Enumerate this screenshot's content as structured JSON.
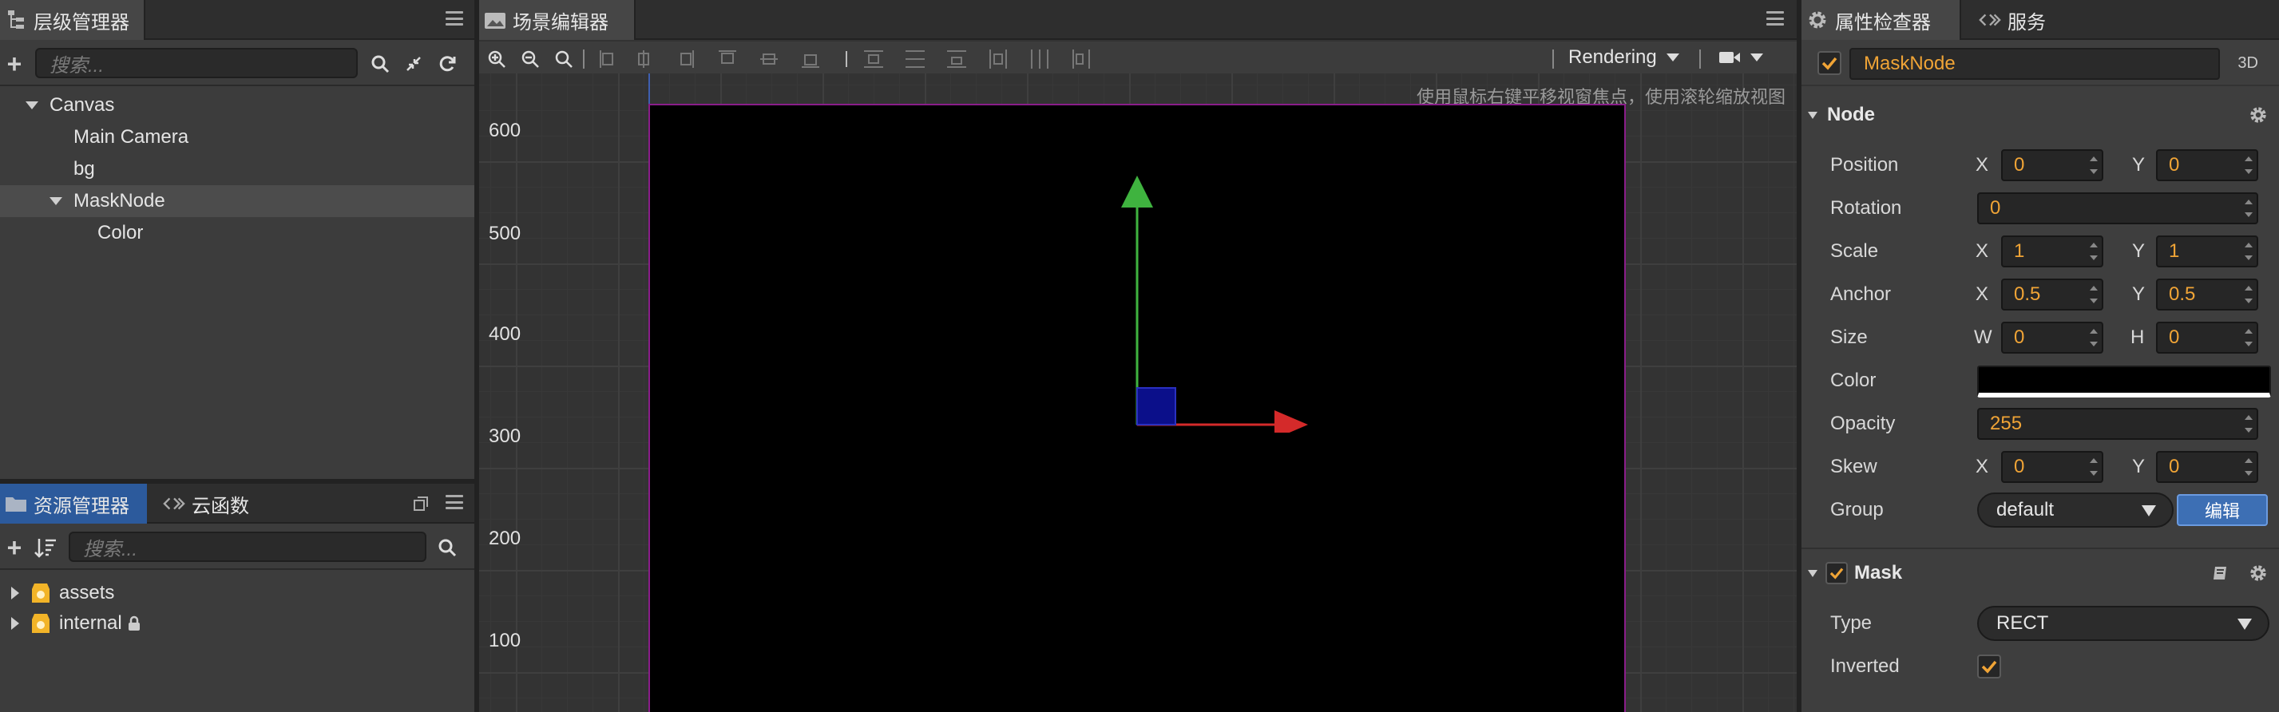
{
  "hierarchy": {
    "tab_label": "层级管理器",
    "search_placeholder": "搜索...",
    "nodes": [
      {
        "label": "Canvas",
        "expanded": true
      },
      {
        "label": "Main Camera"
      },
      {
        "label": "bg"
      },
      {
        "label": "MaskNode",
        "expanded": true,
        "selected": true
      },
      {
        "label": "Color"
      }
    ]
  },
  "assets": {
    "tab_label": "资源管理器",
    "tab2_label": "云函数",
    "search_placeholder": "搜索...",
    "items": [
      {
        "label": "assets"
      },
      {
        "label": "internal",
        "locked": true
      }
    ]
  },
  "scene": {
    "tab_label": "场景编辑器",
    "rendering_label": "Rendering",
    "hint": "使用鼠标右键平移视窗焦点，使用滚轮缩放视图",
    "y_ticks": [
      "600",
      "500",
      "400",
      "300",
      "200",
      "100"
    ]
  },
  "inspector": {
    "tab_label": "属性检查器",
    "tab2_label": "服务",
    "node_name": "MaskNode",
    "mode_label": "3D",
    "node_section": "Node",
    "position": {
      "label": "Position",
      "x_label": "X",
      "x": "0",
      "y_label": "Y",
      "y": "0"
    },
    "rotation": {
      "label": "Rotation",
      "value": "0"
    },
    "scale": {
      "label": "Scale",
      "x_label": "X",
      "x": "1",
      "y_label": "Y",
      "y": "1"
    },
    "anchor": {
      "label": "Anchor",
      "x_label": "X",
      "x": "0.5",
      "y_label": "Y",
      "y": "0.5"
    },
    "size": {
      "label": "Size",
      "w_label": "W",
      "w": "0",
      "h_label": "H",
      "h": "0"
    },
    "color": {
      "label": "Color",
      "value": "#000000"
    },
    "opacity": {
      "label": "Opacity",
      "value": "255"
    },
    "skew": {
      "label": "Skew",
      "x_label": "X",
      "x": "0",
      "y_label": "Y",
      "y": "0"
    },
    "group": {
      "label": "Group",
      "value": "default",
      "edit_label": "编辑"
    },
    "mask_section": "Mask",
    "type": {
      "label": "Type",
      "value": "RECT"
    },
    "inverted": {
      "label": "Inverted",
      "checked": true
    }
  },
  "colors": {
    "accent_orange": "#f0a436",
    "selection_blue": "#2c5a9c",
    "axis_x": "#d42a2a",
    "axis_y": "#3fb33f",
    "canvas_border": "#8a1d8a"
  }
}
